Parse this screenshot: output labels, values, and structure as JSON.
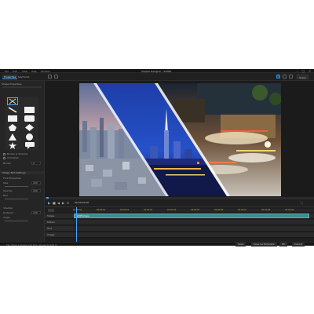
{
  "window": {
    "title": "Shapes Designer - SHAPE"
  },
  "menubar": {
    "items": [
      "File",
      "Edit",
      "View",
      "Help",
      "Window"
    ]
  },
  "toolbar": {
    "tabs": [
      "Properties",
      "Keyframe"
    ],
    "right_label": "Share"
  },
  "left_panel": {
    "section_properties": "Shape Properties",
    "option_border": "Border & Shadow",
    "option_animation": "Animation",
    "border_label": "Border",
    "border_value": "0",
    "section_text": "Shape Text Settings",
    "font_label": "Font Properties",
    "size_label": "Size",
    "size_value": "100",
    "opacity_label": "Opacity",
    "opacity_value": "100",
    "blur_label": "Blur",
    "shadow_label": "Shadow",
    "distance_label": "Distance",
    "distance_value": "100",
    "angle_label": "Angle"
  },
  "playbar": {
    "timecode": "00:00:00:00",
    "end_time": "00:00:10:00"
  },
  "timeline": {
    "ruler": [
      "00:00:00",
      "00:00:01",
      "00:00:02",
      "00:00:03",
      "00:00:04",
      "00:00:05",
      "00:00:06",
      "00:00:07",
      "00:00:08",
      "00:00:09",
      "00:00:10"
    ],
    "tracks": [
      {
        "name": "Shape",
        "clip": "SHAPE.shape"
      },
      {
        "name": "Motion",
        "clip": ""
      },
      {
        "name": "Text",
        "clip": ""
      },
      {
        "name": "Image",
        "clip": ""
      }
    ]
  },
  "statusbar": {
    "text": "Tip: Drag a shape into the canvas to add it",
    "btn_save": "Save",
    "btn_save_as": "Save As Template",
    "btn_ok": "OK",
    "btn_cancel": "Cancel"
  }
}
